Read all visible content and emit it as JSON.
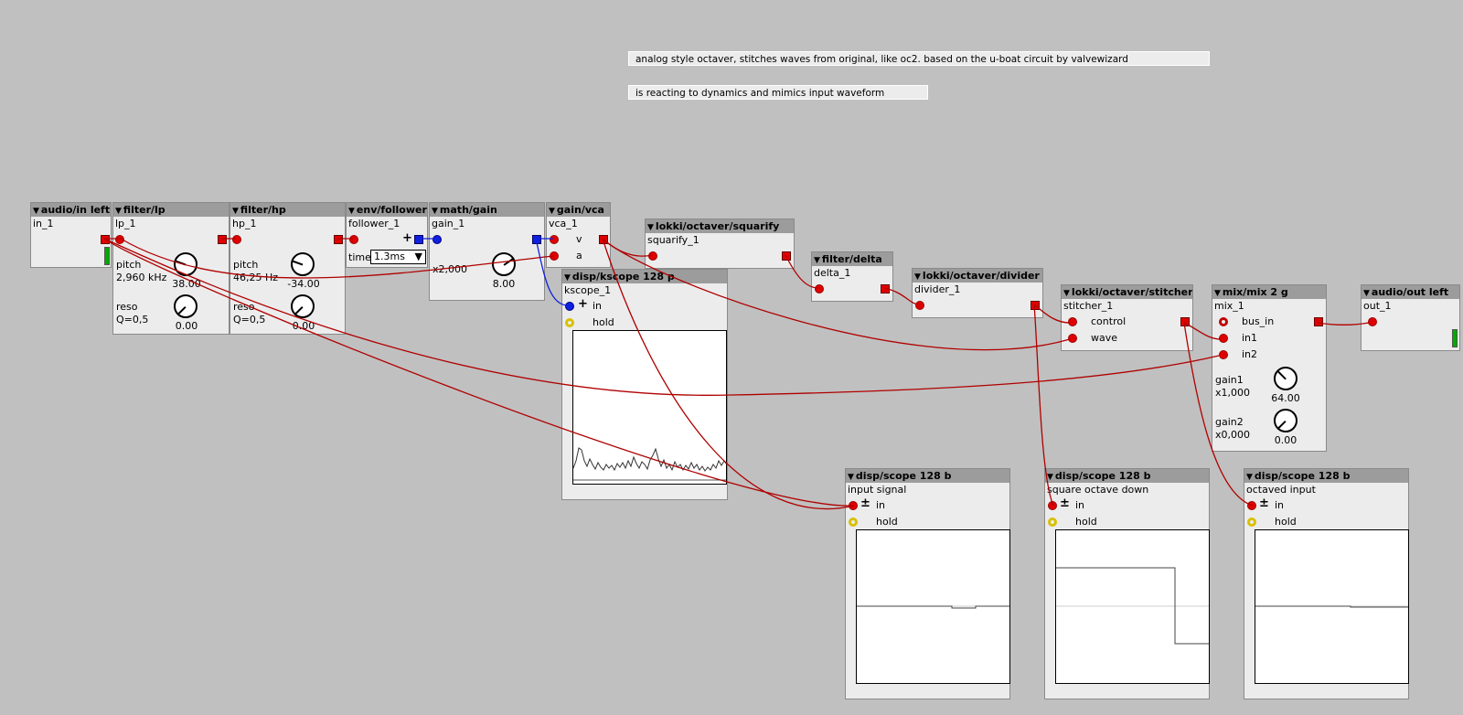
{
  "comments": {
    "c1": "analog style octaver, stitches waves from original, like oc2. based on the u-boat circuit by valvewizard",
    "c2": "is reacting to dynamics and mimics input waveform"
  },
  "objects": {
    "audio_in": {
      "type": "audio/in left",
      "instance": "in_1"
    },
    "lp": {
      "type": "filter/lp",
      "instance": "lp_1",
      "pitch_label": "pitch",
      "pitch_value": "2,960 kHz",
      "pitch_knob": "38.00",
      "reso_label": "reso",
      "reso_value": "Q=0,5",
      "reso_knob": "0.00"
    },
    "hp": {
      "type": "filter/hp",
      "instance": "hp_1",
      "pitch_label": "pitch",
      "pitch_value": "46,25 Hz",
      "pitch_knob": "-34.00",
      "reso_label": "reso",
      "reso_value": "Q=0,5",
      "reso_knob": "0.00"
    },
    "follower": {
      "type": "env/follower",
      "instance": "follower_1",
      "time_label": "time",
      "time_value": "1.3ms"
    },
    "gain": {
      "type": "math/gain",
      "instance": "gain_1",
      "mult": "x2,000",
      "knob": "8.00"
    },
    "vca": {
      "type": "gain/vca",
      "instance": "vca_1",
      "in_v": "v",
      "in_a": "a"
    },
    "kscope": {
      "type": "disp/kscope 128 p",
      "instance": "kscope_1",
      "in_label": "in",
      "hold_label": "hold"
    },
    "squarify": {
      "type": "lokki/octaver/squarify",
      "instance": "squarify_1"
    },
    "delta": {
      "type": "filter/delta",
      "instance": "delta_1"
    },
    "divider": {
      "type": "lokki/octaver/divider",
      "instance": "divider_1"
    },
    "stitcher": {
      "type": "lokki/octaver/stitcher",
      "instance": "stitcher_1",
      "in_control": "control",
      "in_wave": "wave"
    },
    "mix": {
      "type": "mix/mix 2 g",
      "instance": "mix_1",
      "bus_in": "bus_in",
      "in1": "in1",
      "in2": "in2",
      "gain1_label": "gain1",
      "gain1_value": "x1,000",
      "gain1_knob": "64.00",
      "gain2_label": "gain2",
      "gain2_value": "x0,000",
      "gain2_knob": "0.00"
    },
    "audio_out": {
      "type": "audio/out left",
      "instance": "out_1"
    },
    "scope1": {
      "type": "disp/scope 128 b",
      "instance": "input signal",
      "in_label": "in",
      "hold_label": "hold"
    },
    "scope2": {
      "type": "disp/scope 128 b",
      "instance": "square octave down",
      "in_label": "in",
      "hold_label": "hold"
    },
    "scope3": {
      "type": "disp/scope 128 b",
      "instance": "octaved input",
      "in_label": "in",
      "hold_label": "hold"
    }
  },
  "colors": {
    "background": "#c0c0c0",
    "object_body": "#ececec",
    "object_header": "#9c9c9c",
    "audio_port": "#e00000",
    "control_port": "#1020e0",
    "bool_port": "#d8c000",
    "wire_audio": "#b00000",
    "wire_control": "#1020e0"
  }
}
